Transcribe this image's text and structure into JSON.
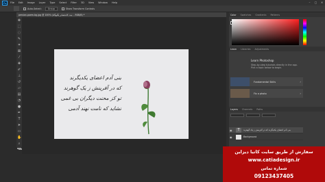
{
  "menubar": {
    "app_icon": "Ps",
    "items": [
      "File",
      "Edit",
      "Image",
      "Layer",
      "Type",
      "Select",
      "Filter",
      "3D",
      "View",
      "Window",
      "Help"
    ]
  },
  "options": {
    "auto_select": "Auto-Select:",
    "group": "Group",
    "transform": "Show Transform Controls"
  },
  "document_tab": {
    "title": "persian-poem-bg.jpg @ 100% (نیت کاندهمانر یگنهگاه ، .RGB/8) *"
  },
  "color_panel": {
    "tabs": [
      "Color",
      "Swatches",
      "Gradients",
      "Patterns"
    ]
  },
  "learn_panel": {
    "tabs": [
      "Learn",
      "Libraries",
      "Adjustments"
    ],
    "title": "Learn Photoshop",
    "description": "Step-by-step tutorials directly in the app. Pick a topic below to begin.",
    "cards": [
      {
        "label": "Fundamental Skills"
      },
      {
        "label": "Fix a photo"
      }
    ]
  },
  "layers_panel": {
    "tabs": [
      "Layers",
      "Channels",
      "Paths"
    ],
    "rows": [
      {
        "name": "بنی آدم اعضای یکدیگرند که در آفرینش ز یک گوهرند"
      },
      {
        "name": "Background"
      }
    ]
  },
  "poem": {
    "lines": [
      "بنی آدم اعضای یکدیگرند",
      "که در آفرینش ز یک گوهرند",
      "تو کز محنت دیگران بی غمی",
      "نشاید که نامت نهند آدمی"
    ]
  },
  "promo": {
    "line1": "سفارش از طریق سایت کاتیا دیزاین",
    "url": "www.catiadesign.ir",
    "line3": "شماره تماس",
    "phone": "09123437405"
  },
  "colors": {
    "promo_bg": "#b00a0a",
    "ps_blue": "#31a8ff"
  }
}
